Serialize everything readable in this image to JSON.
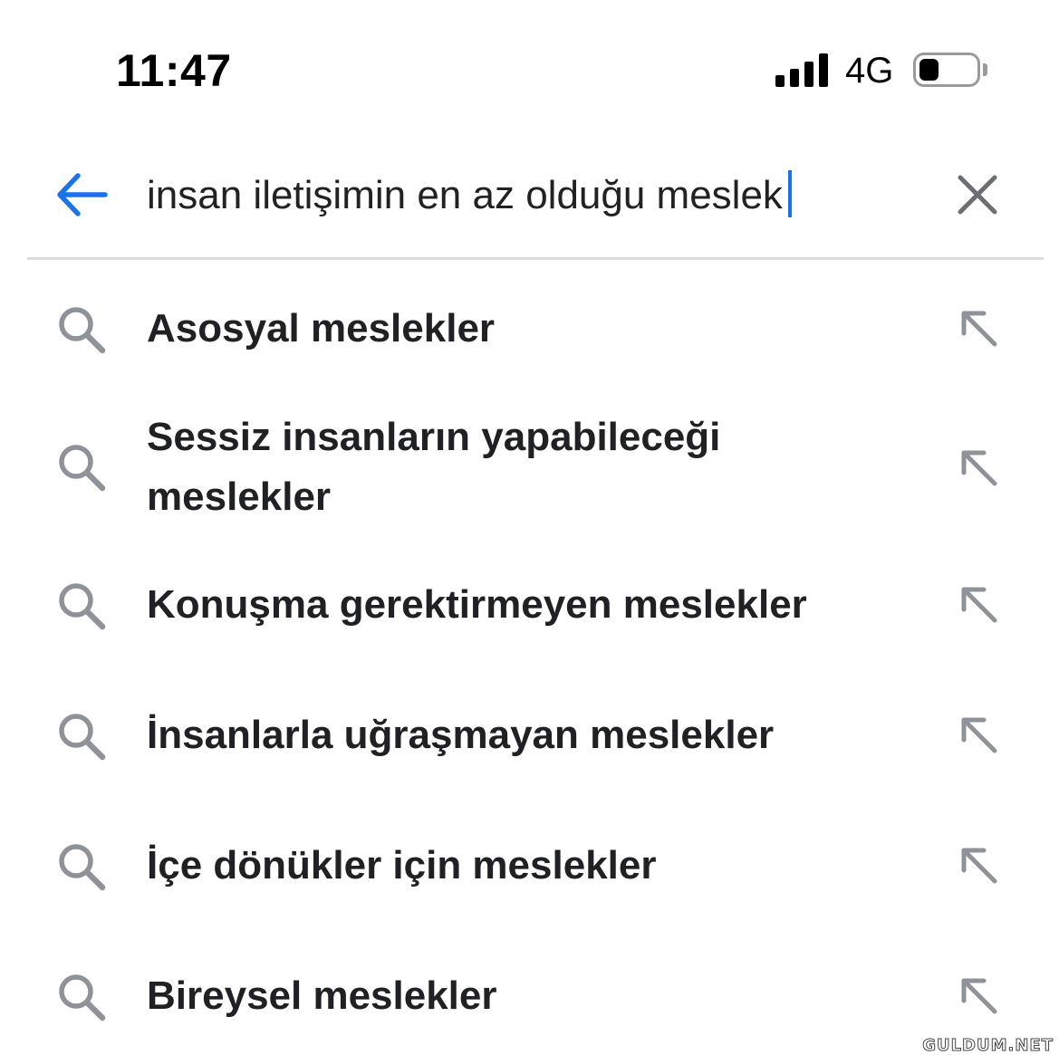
{
  "status_bar": {
    "time": "11:47",
    "network": "4G",
    "battery_level": 0.35
  },
  "search": {
    "query": "insan iletişimin en az olduğu meslek"
  },
  "suggestions": [
    {
      "text": "Asosyal meslekler"
    },
    {
      "text": "Sessiz insanların yapabileceği meslekler"
    },
    {
      "text": "Konuşma gerektirmeyen meslekler"
    },
    {
      "text": "İnsanlarla uğraşmayan meslekler"
    },
    {
      "text": "İçe dönükler için meslekler"
    },
    {
      "text": "Bireysel meslekler"
    }
  ],
  "icons": {
    "back": "arrow-left-icon",
    "clear": "close-icon",
    "suggestion": "search-icon",
    "fill_query": "arrow-up-left-icon"
  },
  "colors": {
    "accent": "#1a73e8",
    "icon_gray": "#8e9399",
    "text": "#202124",
    "divider": "#dadce0"
  },
  "watermark": "GULDUM.NET"
}
